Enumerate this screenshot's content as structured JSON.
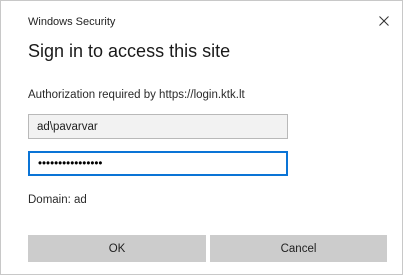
{
  "window": {
    "title": "Windows Security",
    "close_icon": "close-icon"
  },
  "dialog": {
    "heading": "Sign in to access this site",
    "auth_message": "Authorization required by https://login.ktk.lt",
    "username_value": "ad\\pavarvar",
    "password_value": "••••••••••••••••",
    "domain_text": "Domain: ad",
    "ok_label": "OK",
    "cancel_label": "Cancel"
  },
  "colors": {
    "focus_border": "#0a74d6",
    "button_bg": "#cccccc"
  }
}
